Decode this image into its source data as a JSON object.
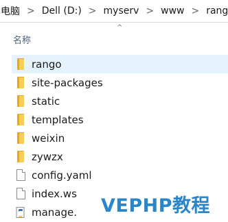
{
  "breadcrumb": {
    "items": [
      "电脑",
      "Dell (D:)",
      "myserv",
      "www",
      "rango"
    ],
    "separator": ">"
  },
  "columns": {
    "name_label": "名称",
    "sort_indicator": "^"
  },
  "files": [
    {
      "name": "rango",
      "type": "folder",
      "icon": "folder-icon",
      "hovered": true
    },
    {
      "name": "site-packages",
      "type": "folder",
      "icon": "folder-icon"
    },
    {
      "name": "static",
      "type": "folder",
      "icon": "folder-icon"
    },
    {
      "name": "templates",
      "type": "folder",
      "icon": "folder-icon"
    },
    {
      "name": "weixin",
      "type": "folder",
      "icon": "folder-icon"
    },
    {
      "name": "zywzx",
      "type": "folder",
      "icon": "folder-icon"
    },
    {
      "name": "config.yaml",
      "type": "file",
      "icon": "file-icon"
    },
    {
      "name": "index.ws",
      "type": "file",
      "icon": "file-icon"
    },
    {
      "name": "manage.",
      "type": "python",
      "icon": "python-file-icon"
    }
  ],
  "watermark": "VEPHP教程",
  "colors": {
    "hover_row": "#e5f3ff",
    "folder_back": "#e0a82e",
    "folder_front": "#f7cf57",
    "header_text": "#4c607a",
    "watermark": "#2a86c9"
  }
}
